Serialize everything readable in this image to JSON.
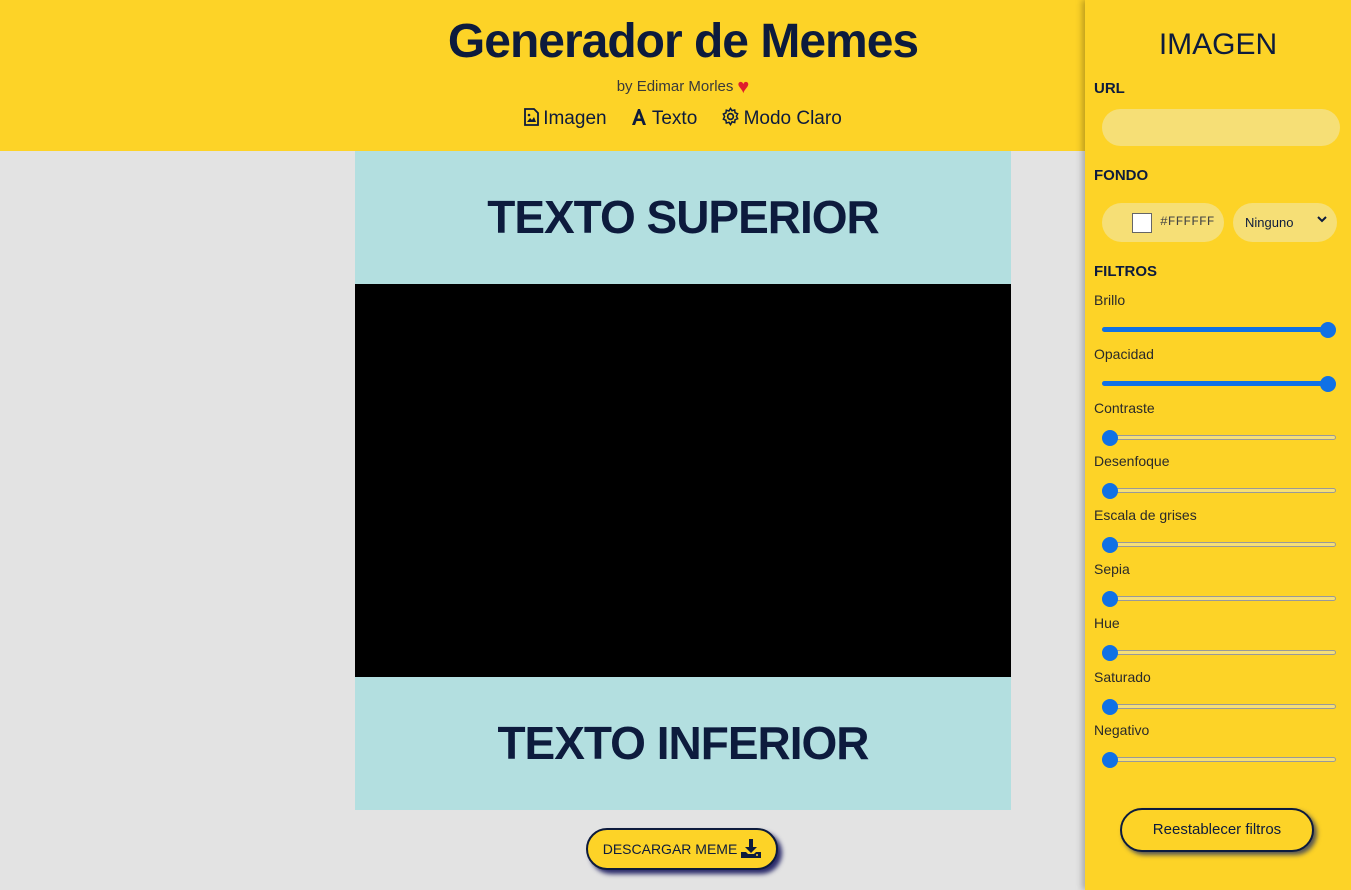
{
  "header": {
    "title": "Generador de Memes",
    "byline": "by Edimar Morles",
    "nav": [
      {
        "label": "Imagen",
        "icon": "image-file-icon"
      },
      {
        "label": "Texto",
        "icon": "text-icon"
      },
      {
        "label": "Modo Claro",
        "icon": "gear-icon"
      }
    ]
  },
  "meme": {
    "top_text": "TEXTO SUPERIOR",
    "bottom_text": "TEXTO INFERIOR",
    "download_label": "DESCARGAR MEME"
  },
  "panel": {
    "title": "IMAGEN",
    "url_label": "URL",
    "url_value": "",
    "background_label": "FONDO",
    "background_color": "#FFFFFF",
    "blend_mode": "Ninguno",
    "filters_label": "FILTROS",
    "filters": [
      {
        "label": "Brillo",
        "value": 1.0
      },
      {
        "label": "Opacidad",
        "value": 1.0
      },
      {
        "label": "Contraste",
        "value": 0.0
      },
      {
        "label": "Desenfoque",
        "value": 0.0
      },
      {
        "label": "Escala de grises",
        "value": 0.0
      },
      {
        "label": "Sepia",
        "value": 0.0
      },
      {
        "label": "Hue",
        "value": 0.0
      },
      {
        "label": "Saturado",
        "value": 0.0
      },
      {
        "label": "Negativo",
        "value": 0.0
      }
    ],
    "reset_label": "Reestablecer filtros"
  },
  "colors": {
    "accent_yellow": "#fdd327",
    "meme_text_bg": "#b3dfe0",
    "slider_blue": "#1071e5",
    "text_dark": "#0d1b3d"
  }
}
